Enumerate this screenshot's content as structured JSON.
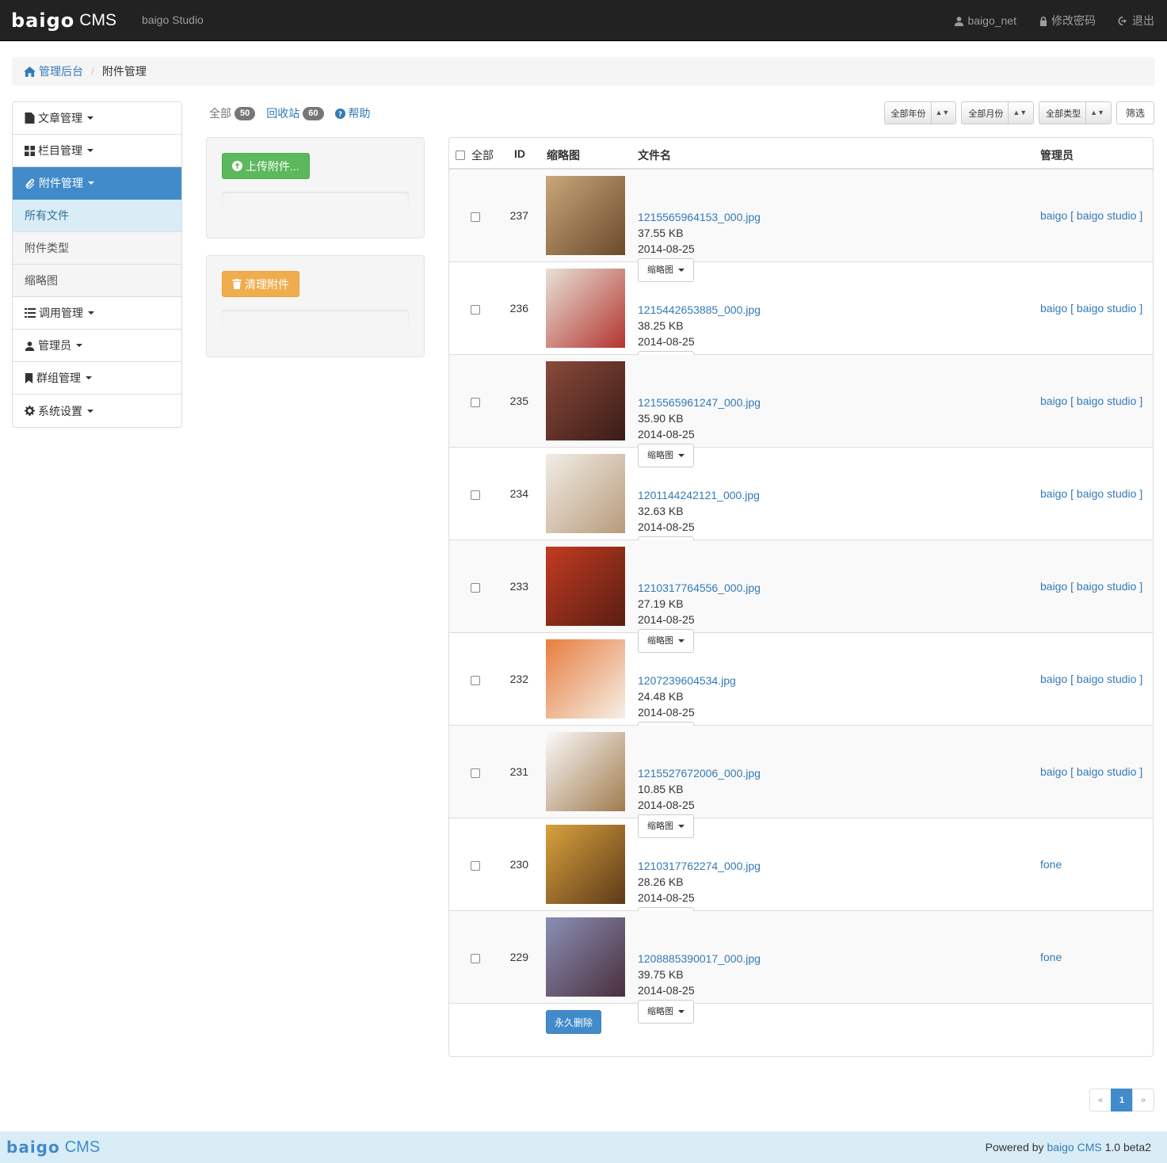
{
  "nav": {
    "logo": "baigo",
    "cms": "CMS",
    "studio": "baigo Studio",
    "user": "baigo_net",
    "change_password": "修改密码",
    "logout": "退出"
  },
  "breadcrumb": {
    "home": "管理后台",
    "current": "附件管理"
  },
  "sidebar": {
    "items": [
      {
        "label": "文章管理",
        "icon": "file-icon"
      },
      {
        "label": "栏目管理",
        "icon": "grid-icon"
      },
      {
        "label": "附件管理",
        "icon": "paperclip-icon",
        "active": true
      },
      {
        "label": "所有文件"
      },
      {
        "label": "附件类型"
      },
      {
        "label": "缩略图"
      },
      {
        "label": "调用管理",
        "icon": "list-icon"
      },
      {
        "label": "管理员",
        "icon": "user-icon"
      },
      {
        "label": "群组管理",
        "icon": "bookmark-icon"
      },
      {
        "label": "系统设置",
        "icon": "gear-icon"
      }
    ]
  },
  "tabs": {
    "all": "全部",
    "all_count": "50",
    "recycle": "回收站",
    "recycle_count": "60",
    "help": "帮助"
  },
  "filters": {
    "year": "全部年份",
    "month": "全部月份",
    "type": "全部类型",
    "submit": "筛选"
  },
  "actions": {
    "upload": "上传附件...",
    "clean": "清理附件",
    "delete": "永久删除"
  },
  "table": {
    "headers": {
      "all": "全部",
      "id": "ID",
      "thumb": "缩略图",
      "filename": "文件名",
      "admin": "管理员"
    },
    "thumb_button": "缩略图",
    "rows": [
      {
        "id": "237",
        "name": "1215565964153_000.jpg",
        "size": "37.55 KB",
        "date": "2014-08-25",
        "admin": "baigo [ baigo studio ]",
        "c1": "#c9a77a",
        "c2": "#6b4a2c"
      },
      {
        "id": "236",
        "name": "1215442653885_000.jpg",
        "size": "38.25 KB",
        "date": "2014-08-25",
        "admin": "baigo [ baigo studio ]",
        "c1": "#e8e2d8",
        "c2": "#b3352e"
      },
      {
        "id": "235",
        "name": "1215565961247_000.jpg",
        "size": "35.90 KB",
        "date": "2014-08-25",
        "admin": "baigo [ baigo studio ]",
        "c1": "#8a4a3a",
        "c2": "#3a1c18"
      },
      {
        "id": "234",
        "name": "1201144242121_000.jpg",
        "size": "32.63 KB",
        "date": "2014-08-25",
        "admin": "baigo [ baigo studio ]",
        "c1": "#f2ede6",
        "c2": "#b89a7a"
      },
      {
        "id": "233",
        "name": "1210317764556_000.jpg",
        "size": "27.19 KB",
        "date": "2014-08-25",
        "admin": "baigo [ baigo studio ]",
        "c1": "#c23b22",
        "c2": "#5a1e12"
      },
      {
        "id": "232",
        "name": "1207239604534.jpg",
        "size": "24.48 KB",
        "date": "2014-08-25",
        "admin": "baigo [ baigo studio ]",
        "c1": "#e87d3e",
        "c2": "#f5efe6"
      },
      {
        "id": "231",
        "name": "1215527672006_000.jpg",
        "size": "10.85 KB",
        "date": "2014-08-25",
        "admin": "baigo [ baigo studio ]",
        "c1": "#fafafa",
        "c2": "#a07a4e"
      },
      {
        "id": "230",
        "name": "1210317762274_000.jpg",
        "size": "28.26 KB",
        "date": "2014-08-25",
        "admin": "fone",
        "c1": "#d9a23e",
        "c2": "#5b3a18"
      },
      {
        "id": "229",
        "name": "1208885390017_000.jpg",
        "size": "39.75 KB",
        "date": "2014-08-25",
        "admin": "fone",
        "c1": "#8a8fb5",
        "c2": "#4a2f3c"
      }
    ]
  },
  "pagination": {
    "prev": "«",
    "current": "1",
    "next": "»"
  },
  "footer": {
    "logo": "baigo",
    "cms": "CMS",
    "powered_prefix": "Powered by",
    "powered_link": "baigo CMS",
    "version": "1.0 beta2"
  }
}
